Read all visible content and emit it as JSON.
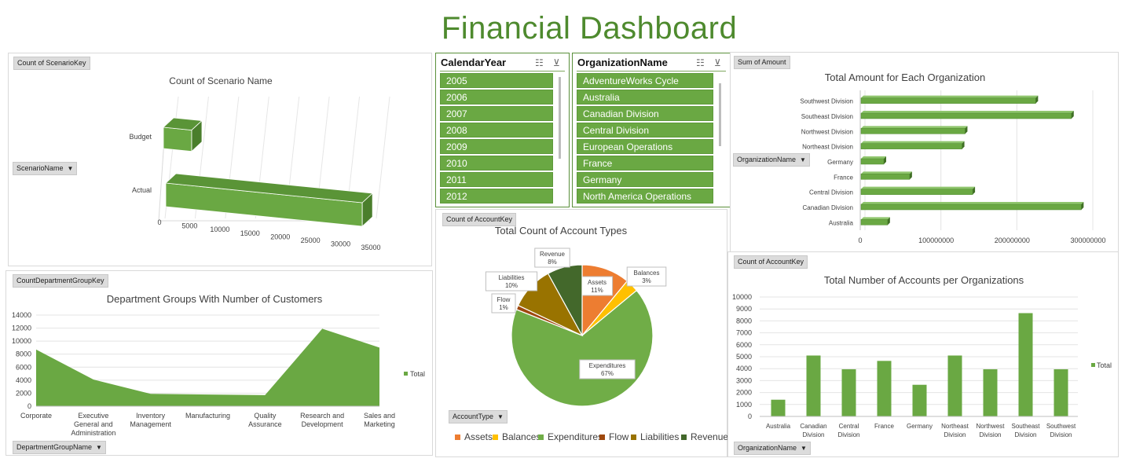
{
  "title": "Financial Dashboard",
  "slicers": {
    "calendar": {
      "header": "CalendarYear",
      "items": [
        "2005",
        "2006",
        "2007",
        "2008",
        "2009",
        "2010",
        "2011",
        "2012"
      ]
    },
    "organization": {
      "header": "OrganizationName",
      "items": [
        "AdventureWorks Cycle",
        "Australia",
        "Canadian Division",
        "Central Division",
        "European Operations",
        "France",
        "Germany",
        "North America Operations"
      ]
    }
  },
  "colors": {
    "green": "#6aa843",
    "title_green": "#4e8a2e",
    "assets": "#ed7d31",
    "balances": "#ffc000",
    "expenditures": "#70ad47",
    "flow": "#9e480e",
    "liabilities": "#997300",
    "revenue": "#43682b"
  },
  "panels": {
    "scenario": {
      "tag": "Count of ScenarioKey",
      "field": "ScenarioName"
    },
    "department": {
      "tag": "CountDepartmentGroupKey",
      "field": "DepartmentGroupName",
      "legend": "Total"
    },
    "account_types": {
      "tag": "Count of AccountKey",
      "field": "AccountType"
    },
    "org_amount": {
      "tag": "Sum of Amount",
      "field": "OrganizationName"
    },
    "org_accounts": {
      "tag": "Count of AccountKey",
      "field": "OrganizationName",
      "legend": "Total"
    }
  },
  "chart_data": [
    {
      "id": "scenario",
      "type": "bar",
      "title": "Count of Scenario Name",
      "categories": [
        "Budget",
        "Actual"
      ],
      "values": [
        3000,
        34500
      ],
      "xticks": [
        "0",
        "5000",
        "10000",
        "15000",
        "20000",
        "25000",
        "30000",
        "35000"
      ],
      "xlim": [
        0,
        35000
      ]
    },
    {
      "id": "department",
      "type": "area",
      "title": "Department Groups With Number of Customers",
      "categories": [
        "Corporate",
        "Executive General and Administration",
        "Inventory Management",
        "Manufacturing",
        "Quality Assurance",
        "Research and Development",
        "Sales and Marketing"
      ],
      "category_lines": [
        [
          "Corporate"
        ],
        [
          "Executive",
          "General and",
          "Administration"
        ],
        [
          "Inventory",
          "Management"
        ],
        [
          "Manufacturing"
        ],
        [
          "Quality",
          "Assurance"
        ],
        [
          "Research and",
          "Development"
        ],
        [
          "Sales and",
          "Marketing"
        ]
      ],
      "series": [
        {
          "name": "Total",
          "values": [
            8700,
            4100,
            1900,
            1800,
            1700,
            11900,
            9000
          ]
        }
      ],
      "ylim": [
        0,
        14000
      ],
      "yticks": [
        0,
        2000,
        4000,
        6000,
        8000,
        10000,
        12000,
        14000
      ]
    },
    {
      "id": "account_types",
      "type": "pie",
      "title": "Total Count of Account Types",
      "slices": [
        {
          "label": "Assets",
          "percent": 11,
          "pct_text": "11%"
        },
        {
          "label": "Balances",
          "percent": 3,
          "pct_text": "3%"
        },
        {
          "label": "Expenditures",
          "percent": 67,
          "pct_text": "67%"
        },
        {
          "label": "Flow",
          "percent": 1,
          "pct_text": "1%"
        },
        {
          "label": "Liabilities",
          "percent": 10,
          "pct_text": "10%"
        },
        {
          "label": "Revenue",
          "percent": 8,
          "pct_text": "8%"
        }
      ],
      "legend": [
        "Assets",
        "Balances",
        "Expenditures",
        "Flow",
        "Liabilities",
        "Revenue"
      ]
    },
    {
      "id": "org_amount",
      "type": "bar",
      "title": "Total Amount for Each Organization",
      "categories": [
        "Southwest Division",
        "Southeast Division",
        "Northwest Division",
        "Northeast Division",
        "Germany",
        "France",
        "Central Division",
        "Canadian Division",
        "Australia"
      ],
      "values": [
        230000000,
        277000000,
        137000000,
        133000000,
        30000000,
        64000000,
        147000000,
        290000000,
        35000000
      ],
      "xticks": [
        "0",
        "100000000",
        "200000000",
        "300000000"
      ],
      "xlim": [
        0,
        300000000
      ]
    },
    {
      "id": "org_accounts",
      "type": "bar",
      "title": "Total Number of Accounts per Organizations",
      "categories": [
        "Australia",
        "Canadian Division",
        "Central Division",
        "France",
        "Germany",
        "Northeast Division",
        "Northwest Division",
        "Southeast Division",
        "Southwest Division"
      ],
      "category_lines": [
        [
          "Australia"
        ],
        [
          "Canadian",
          "Division"
        ],
        [
          "Central",
          "Division"
        ],
        [
          "France"
        ],
        [
          "Germany"
        ],
        [
          "Northeast",
          "Division"
        ],
        [
          "Northwest",
          "Division"
        ],
        [
          "Southeast",
          "Division"
        ],
        [
          "Southwest",
          "Division"
        ]
      ],
      "series": [
        {
          "name": "Total",
          "values": [
            1400,
            5100,
            3950,
            4650,
            2650,
            5100,
            3950,
            8650,
            3950
          ]
        }
      ],
      "ylim": [
        0,
        10000
      ],
      "yticks": [
        0,
        1000,
        2000,
        3000,
        4000,
        5000,
        6000,
        7000,
        8000,
        9000,
        10000
      ]
    }
  ]
}
